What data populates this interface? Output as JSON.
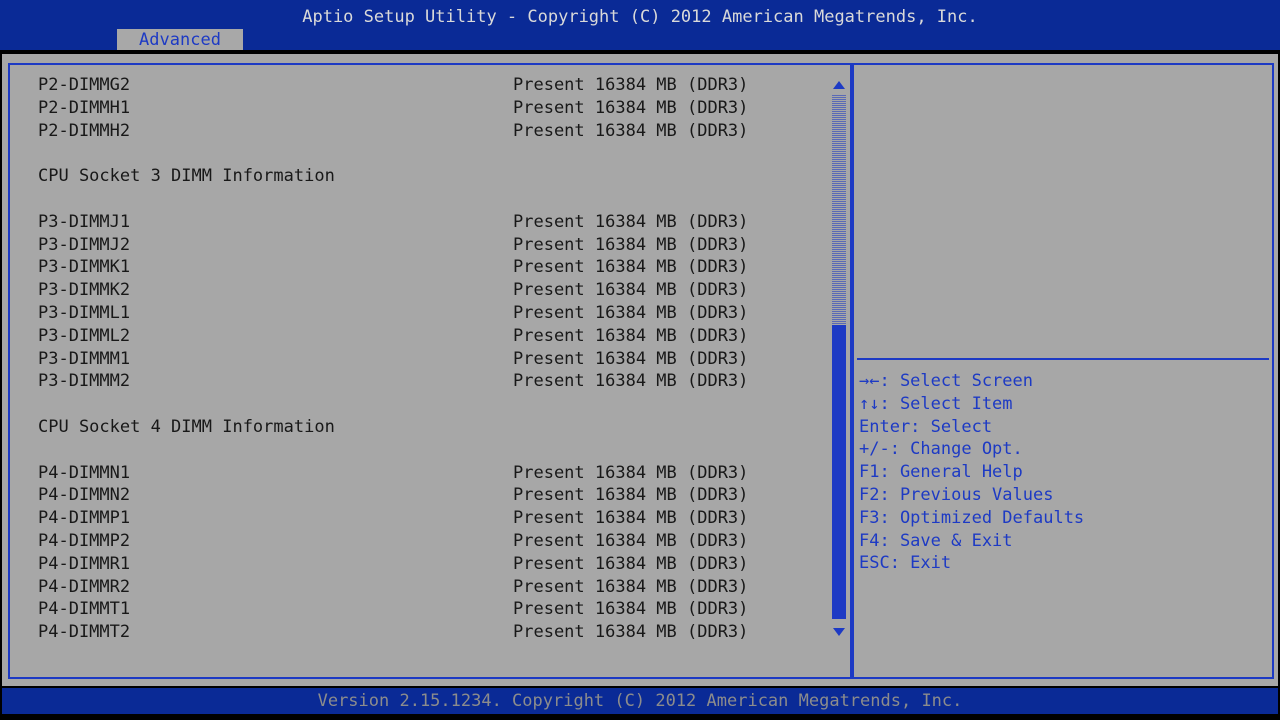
{
  "header": {
    "title": "Aptio Setup Utility - Copyright (C) 2012 American Megatrends, Inc.",
    "active_tab": "Advanced"
  },
  "memory_list": [
    {
      "label": "P2-DIMMG2",
      "value": "Present 16384 MB (DDR3)"
    },
    {
      "label": "P2-DIMMH1",
      "value": "Present 16384 MB (DDR3)"
    },
    {
      "label": "P2-DIMMH2",
      "value": "Present 16384 MB (DDR3)"
    },
    {
      "label": "",
      "value": ""
    },
    {
      "label": "CPU Socket 3 DIMM Information",
      "value": ""
    },
    {
      "label": "",
      "value": ""
    },
    {
      "label": "P3-DIMMJ1",
      "value": "Present 16384 MB (DDR3)"
    },
    {
      "label": "P3-DIMMJ2",
      "value": "Present 16384 MB (DDR3)"
    },
    {
      "label": "P3-DIMMK1",
      "value": "Present 16384 MB (DDR3)"
    },
    {
      "label": "P3-DIMMK2",
      "value": "Present 16384 MB (DDR3)"
    },
    {
      "label": "P3-DIMML1",
      "value": "Present 16384 MB (DDR3)"
    },
    {
      "label": "P3-DIMML2",
      "value": "Present 16384 MB (DDR3)"
    },
    {
      "label": "P3-DIMMM1",
      "value": "Present 16384 MB (DDR3)"
    },
    {
      "label": "P3-DIMMM2",
      "value": "Present 16384 MB (DDR3)"
    },
    {
      "label": "",
      "value": ""
    },
    {
      "label": "CPU Socket 4 DIMM Information",
      "value": ""
    },
    {
      "label": "",
      "value": ""
    },
    {
      "label": "P4-DIMMN1",
      "value": "Present 16384 MB (DDR3)"
    },
    {
      "label": "P4-DIMMN2",
      "value": "Present 16384 MB (DDR3)"
    },
    {
      "label": "P4-DIMMP1",
      "value": "Present 16384 MB (DDR3)"
    },
    {
      "label": "P4-DIMMP2",
      "value": "Present 16384 MB (DDR3)"
    },
    {
      "label": "P4-DIMMR1",
      "value": "Present 16384 MB (DDR3)"
    },
    {
      "label": "P4-DIMMR2",
      "value": "Present 16384 MB (DDR3)"
    },
    {
      "label": "P4-DIMMT1",
      "value": "Present 16384 MB (DDR3)"
    },
    {
      "label": "P4-DIMMT2",
      "value": "Present 16384 MB (DDR3)"
    }
  ],
  "help": [
    "→←: Select Screen",
    "↑↓: Select Item",
    "Enter: Select",
    "+/-: Change Opt.",
    "F1: General Help",
    "F2: Previous Values",
    "F3: Optimized Defaults",
    "F4: Save & Exit",
    "ESC: Exit"
  ],
  "footer": {
    "text": "Version 2.15.1234. Copyright (C) 2012 American Megatrends, Inc."
  },
  "scrollbar": {
    "position_fraction": 0.45
  },
  "colors": {
    "header_bg": "#0a2a96",
    "panel_bg": "#a7a7a7",
    "accent": "#1d3ac4",
    "text": "#181818"
  }
}
